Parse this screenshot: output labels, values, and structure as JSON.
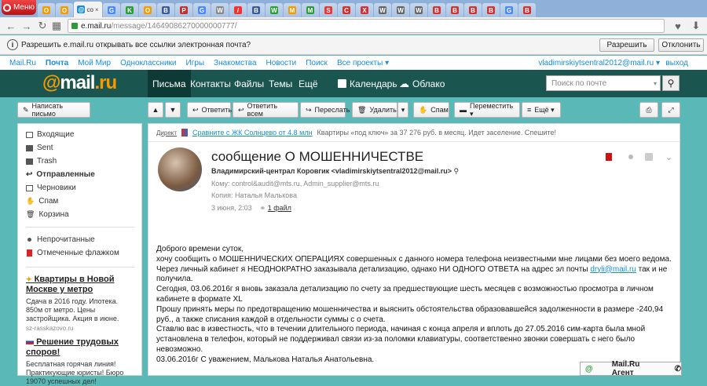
{
  "browser": {
    "menu_label": "Меню",
    "tabs": [
      {
        "fav": "О",
        "color": "#f59a00"
      },
      {
        "fav": "О",
        "color": "#f59a00"
      },
      {
        "fav": "@",
        "color": "#168de2",
        "label": "co",
        "active": true
      },
      {
        "fav": "G",
        "color": "#4a8af4"
      },
      {
        "fav": "K",
        "color": "#2a9d3a"
      },
      {
        "fav": "O",
        "color": "#f59a00"
      },
      {
        "fav": "B",
        "color": "#3b5998"
      },
      {
        "fav": "P",
        "color": "#c4302b"
      },
      {
        "fav": "G",
        "color": "#4a8af4"
      },
      {
        "fav": "W",
        "color": "#888"
      },
      {
        "fav": "/",
        "color": "#e33"
      },
      {
        "fav": "B",
        "color": "#3b5998"
      },
      {
        "fav": "W",
        "color": "#2a9d3a"
      },
      {
        "fav": "M",
        "color": "#f59a00"
      },
      {
        "fav": "M",
        "color": "#2a9d3a"
      },
      {
        "fav": "S",
        "color": "#e33"
      },
      {
        "fav": "C",
        "color": "#c33"
      },
      {
        "fav": "X",
        "color": "#c33"
      },
      {
        "fav": "W",
        "color": "#666"
      },
      {
        "fav": "W",
        "color": "#666"
      },
      {
        "fav": "W",
        "color": "#666"
      },
      {
        "fav": "B",
        "color": "#c33"
      },
      {
        "fav": "B",
        "color": "#c33"
      },
      {
        "fav": "B",
        "color": "#c33"
      },
      {
        "fav": "B",
        "color": "#c33"
      },
      {
        "fav": "G",
        "color": "#4a8af4"
      },
      {
        "fav": "B",
        "color": "#c33"
      }
    ],
    "url_domain": "e.mail.ru",
    "url_path": "/message/14649086270000000777/"
  },
  "notification": {
    "text": "Разрешить e.mail.ru открывать все ссылки электронная почта?",
    "allow": "Разрешить",
    "deny": "Отклонить"
  },
  "portal": {
    "items": [
      "Mail.Ru",
      "Почта",
      "Мой Мир",
      "Одноклассники",
      "Игры",
      "Знакомства",
      "Новости",
      "Поиск",
      "Все проекты ▾"
    ],
    "user": "vladimirskiytsentral2012@mail.ru ▾",
    "exit": "выход"
  },
  "header": {
    "logo_at": "@",
    "logo_mail": "mail",
    "logo_ru": ".ru",
    "nav": [
      "Письма",
      "Контакты",
      "Файлы",
      "Темы",
      "Ещё"
    ],
    "calendar": "Календарь",
    "cloud": "Облако",
    "search_placeholder": "Поиск по почте"
  },
  "toolbar": {
    "compose": "Написать письмо",
    "reply": "Ответить",
    "reply_all": "Ответить всем",
    "forward": "Переслать",
    "delete": "Удалить",
    "spam": "Спам",
    "move": "Переместить ▾",
    "more": "Ещё ▾"
  },
  "sidebar": {
    "folders": [
      "Входящие",
      "Sent",
      "Trash",
      "Отправленные",
      "Черновики",
      "Спам",
      "Корзина"
    ],
    "filters": [
      "Непрочитанные",
      "Отмеченные флажком"
    ],
    "promo1": {
      "title": "Квартиры в Новой Москве у метро",
      "body": "Сдача в 2016 году. Ипотека. 850м от метро. Цены застройщика. Акция в июне.",
      "link": "sz-rasskazovo.ru"
    },
    "promo2": {
      "title": "Решение трудовых споров!",
      "body": "Бесплатная горячая линия! Практикующие юристы! Бюро 19070 успешных дел!"
    }
  },
  "message": {
    "direct_label": "Директ",
    "direct_ad": "Сравните с ЖК Солнцево от 4.8 млн",
    "direct_text": "Квартиры «под ключ» за 37 276 руб. в месяц. Идет заселение. Спешите!",
    "subject": "сообщение О МОШЕННИЧЕСТВЕ",
    "from": "Владимирский-централ Коровгик <vladimirskiytsentral2012@mail.ru>",
    "to": "Кому: control&audit@mts.ru, Admin_supplier@mts.ru",
    "cc": "Копия: Наталья Малькова",
    "date": "3 июня, 2:03",
    "attachment": "1 файл",
    "body_lines": {
      "l1": "Доброго времени суток,",
      "l2": "хочу сообщить о МОШЕННИЧЕСКИХ ОПЕРАЦИЯХ совершенных с данного номера телефона неизвестными мне лицами без моего ведома.",
      "l3a": "Через личный кабинет я НЕОДНОКРАТНО заказывала детализацию, однако НИ ОДНОГО ОТВЕТА на адрес эл почты ",
      "l3link": "dryli@mail.ru",
      "l3b": " так и не получила.",
      "l4": "Сегодня, 03.06.2016г я вновь заказала детализацию по счету за предшествующие шесть месяцев с возможностью просмотра в личном кабинете в формате XL",
      "l5": "Прошу принять меры по предотвращению мошенничества и выяснить обстоятельства образовавшейся задолженности в размере -240,94 руб., а также списания каждой в отдельности суммы с о счета.",
      "l6": "Ставлю вас в известность, что в течении длительного периода, начиная с конца апреля и вплоть до 27.05.2016 сим-карта была мной установлена в телефон, который не поддерживал связи из-за поломки клавиатуры, соответственно звонки совершать с него было невозможно.",
      "l7": "03.06.2016г                          С уважением, Малькова Наталья Анатольевна."
    }
  },
  "agent": "Mail.Ru Агент"
}
